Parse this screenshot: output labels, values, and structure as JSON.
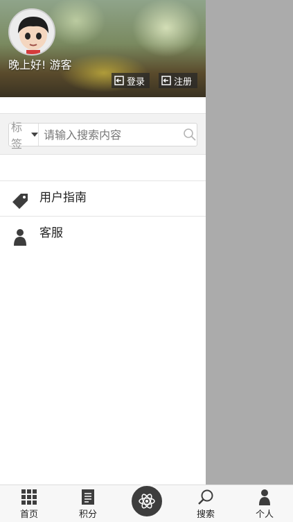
{
  "header": {
    "greeting": "晚上好! 游客",
    "login_label": "登录",
    "register_label": "注册"
  },
  "search": {
    "tag_label": "标签",
    "placeholder": "请输入搜索内容",
    "value": ""
  },
  "menu": {
    "items": [
      {
        "label": "用户指南",
        "icon": "tag-icon"
      },
      {
        "label": "客服",
        "icon": "person-icon"
      }
    ]
  },
  "tabbar": {
    "home": "首页",
    "points": "积分",
    "center_icon": "atom-icon",
    "search": "搜索",
    "personal": "个人"
  },
  "colors": {
    "overlay": "#ababab",
    "icon_dark": "#3d3d3d",
    "tab_bg": "#f7f7f7"
  }
}
